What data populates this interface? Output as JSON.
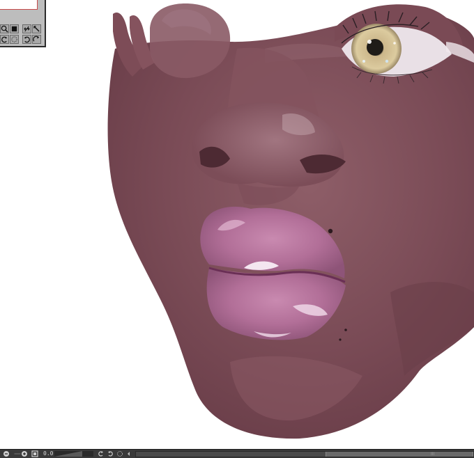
{
  "app": {
    "canvas": {
      "subject": ""
    },
    "navigator": {
      "buttons": [
        {
          "icon": "zoom-in-icon"
        },
        {
          "icon": "fit-window-icon"
        },
        {
          "icon": "flip-horizontal-icon"
        },
        {
          "icon": "flip-vertical-icon"
        },
        {
          "icon": "rotate-left-icon"
        },
        {
          "icon": "rotate-reset-icon"
        },
        {
          "icon": "rotate-right-icon"
        },
        {
          "icon": "reset-view-icon"
        }
      ]
    },
    "status_bar": {
      "zoom_out_icon": "zoom-out-icon",
      "zoom_in_icon": "zoom-in-icon",
      "fit_icon": "fit-icon",
      "zoom_value": "0.0",
      "rotate_left_icon": "rotate-left-icon",
      "rotate_right_icon": "rotate-right-icon",
      "rotate_reset_icon": "rotate-reset-icon",
      "scroll_left_icon": "scroll-left-icon",
      "hscroll_position": 0.55,
      "hscroll_grip": "III"
    },
    "colors": {
      "skin_base": "#7a4a55",
      "skin_light": "#9a6a74",
      "lip": "#b7719b",
      "lip_highlight": "#e6cbe0",
      "iris": "#d8c59a",
      "ui_panel": "#bdbdbd",
      "ui_bar": "#3a3a3a"
    }
  }
}
